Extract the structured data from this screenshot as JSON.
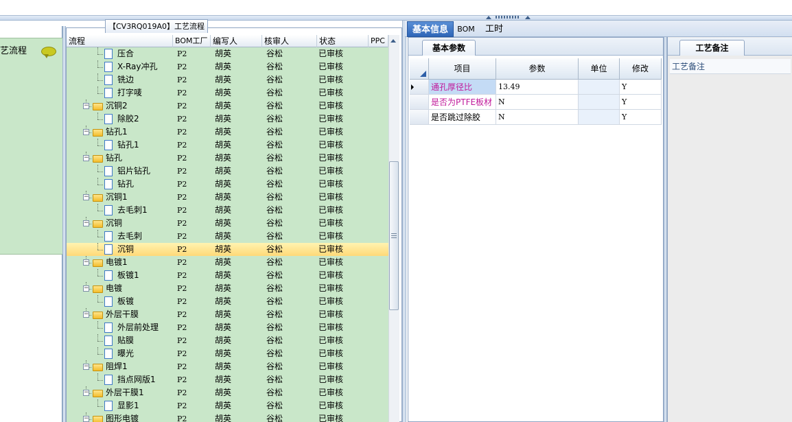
{
  "left_panel": {
    "title": "艺流程",
    "chat_icon": "speech-bubble-icon"
  },
  "process_tab": {
    "label": "【CV3RQ019A0】工艺流程"
  },
  "tree": {
    "columns": [
      "流程",
      "BOM工厂",
      "编写人",
      "核审人",
      "状态",
      "PPC"
    ],
    "rows": [
      {
        "name": "压合",
        "type": "doc",
        "bom": "P2",
        "writer": "胡英",
        "reviewer": "谷松",
        "status": "已审核"
      },
      {
        "name": "X-Ray冲孔",
        "type": "doc",
        "bom": "P2",
        "writer": "胡英",
        "reviewer": "谷松",
        "status": "已审核"
      },
      {
        "name": "铣边",
        "type": "doc",
        "bom": "P2",
        "writer": "胡英",
        "reviewer": "谷松",
        "status": "已审核"
      },
      {
        "name": "打字唛",
        "type": "doc",
        "bom": "P2",
        "writer": "胡英",
        "reviewer": "谷松",
        "status": "已审核"
      },
      {
        "name": "沉铜2",
        "type": "folder",
        "bom": "P2",
        "writer": "胡英",
        "reviewer": "谷松",
        "status": "已审核"
      },
      {
        "name": "除胶2",
        "type": "doc",
        "bom": "P2",
        "writer": "胡英",
        "reviewer": "谷松",
        "status": "已审核"
      },
      {
        "name": "钻孔1",
        "type": "folder",
        "bom": "P2",
        "writer": "胡英",
        "reviewer": "谷松",
        "status": "已审核"
      },
      {
        "name": "钻孔1",
        "type": "doc",
        "bom": "P2",
        "writer": "胡英",
        "reviewer": "谷松",
        "status": "已审核"
      },
      {
        "name": "钻孔",
        "type": "folder",
        "bom": "P2",
        "writer": "胡英",
        "reviewer": "谷松",
        "status": "已审核"
      },
      {
        "name": "铝片钻孔",
        "type": "doc",
        "bom": "P2",
        "writer": "胡英",
        "reviewer": "谷松",
        "status": "已审核"
      },
      {
        "name": "钻孔",
        "type": "doc",
        "bom": "P2",
        "writer": "胡英",
        "reviewer": "谷松",
        "status": "已审核"
      },
      {
        "name": "沉铜1",
        "type": "folder",
        "bom": "P2",
        "writer": "胡英",
        "reviewer": "谷松",
        "status": "已审核"
      },
      {
        "name": "去毛刺1",
        "type": "doc",
        "bom": "P2",
        "writer": "胡英",
        "reviewer": "谷松",
        "status": "已审核"
      },
      {
        "name": "沉铜",
        "type": "folder",
        "bom": "P2",
        "writer": "胡英",
        "reviewer": "谷松",
        "status": "已审核"
      },
      {
        "name": "去毛刺",
        "type": "doc",
        "bom": "P2",
        "writer": "胡英",
        "reviewer": "谷松",
        "status": "已审核"
      },
      {
        "name": "沉铜",
        "type": "doc",
        "bom": "P2",
        "writer": "胡英",
        "reviewer": "谷松",
        "status": "已审核",
        "selected": true
      },
      {
        "name": "电镀1",
        "type": "folder",
        "bom": "P2",
        "writer": "胡英",
        "reviewer": "谷松",
        "status": "已审核"
      },
      {
        "name": "板镀1",
        "type": "doc",
        "bom": "P2",
        "writer": "胡英",
        "reviewer": "谷松",
        "status": "已审核"
      },
      {
        "name": "电镀",
        "type": "folder",
        "bom": "P2",
        "writer": "胡英",
        "reviewer": "谷松",
        "status": "已审核"
      },
      {
        "name": "板镀",
        "type": "doc",
        "bom": "P2",
        "writer": "胡英",
        "reviewer": "谷松",
        "status": "已审核"
      },
      {
        "name": "外层干膜",
        "type": "folder",
        "bom": "P2",
        "writer": "胡英",
        "reviewer": "谷松",
        "status": "已审核"
      },
      {
        "name": "外层前处理",
        "type": "doc",
        "bom": "P2",
        "writer": "胡英",
        "reviewer": "谷松",
        "status": "已审核"
      },
      {
        "name": "贴膜",
        "type": "doc",
        "bom": "P2",
        "writer": "胡英",
        "reviewer": "谷松",
        "status": "已审核"
      },
      {
        "name": "曝光",
        "type": "doc",
        "bom": "P2",
        "writer": "胡英",
        "reviewer": "谷松",
        "status": "已审核"
      },
      {
        "name": "阻焊1",
        "type": "folder",
        "bom": "P2",
        "writer": "胡英",
        "reviewer": "谷松",
        "status": "已审核"
      },
      {
        "name": "挡点网版1",
        "type": "doc",
        "bom": "P2",
        "writer": "胡英",
        "reviewer": "谷松",
        "status": "已审核"
      },
      {
        "name": "外层干膜1",
        "type": "folder",
        "bom": "P2",
        "writer": "胡英",
        "reviewer": "谷松",
        "status": "已审核"
      },
      {
        "name": "显影1",
        "type": "doc",
        "bom": "P2",
        "writer": "胡英",
        "reviewer": "谷松",
        "status": "已审核"
      },
      {
        "name": "图形电镀",
        "type": "folder",
        "bom": "P2",
        "writer": "胡英",
        "reviewer": "谷松",
        "status": "已审核"
      }
    ]
  },
  "right_tabs": [
    "基本信息",
    "BOM",
    "工时"
  ],
  "params": {
    "subtab": "基本参数",
    "columns": [
      "项目",
      "参数",
      "单位",
      "修改"
    ],
    "rows": [
      {
        "item": "通孔厚径比",
        "value": "13.49",
        "unit": "",
        "modify": "Y",
        "current": true
      },
      {
        "item": "是否为PTFE板材",
        "value": "N",
        "unit": "",
        "modify": "Y"
      },
      {
        "item": "是否跳过除胶",
        "value": "N",
        "unit": "",
        "modify": "Y"
      }
    ]
  },
  "notes": {
    "tab": "工艺备注",
    "label": "工艺备注"
  },
  "colors": {
    "tree_bg": "#c9e7c9",
    "selected_row": "#ffd977",
    "active_tab": "#2e66b8",
    "param_item_text": "#c0189a"
  }
}
